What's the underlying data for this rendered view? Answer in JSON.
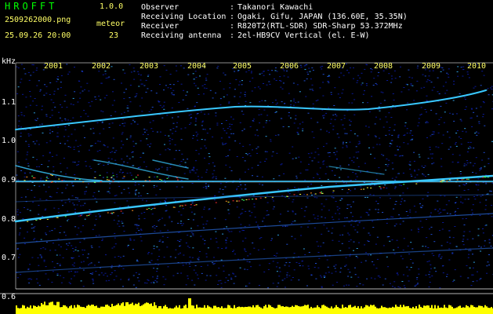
{
  "header": {
    "app_name": "HROFFT",
    "version": "1.0.0",
    "file_name": "2509262000.png",
    "datetime": "25.09.26 20:00",
    "meteor_label": "meteor",
    "meteor_count": "23"
  },
  "info": [
    {
      "key": "Observer",
      "value": "Takanori Kawachi"
    },
    {
      "key": "Receiving Location",
      "value": "Ogaki, Gifu, JAPAN (136.60E, 35.35N)"
    },
    {
      "key": "Receiver",
      "value": "R820T2(RTL-SDR) SDR-Sharp 53.372MHz"
    },
    {
      "key": "Receiving antenna",
      "value": "2el-HB9CV Vertical (el. E-W)"
    }
  ],
  "spectrogram": {
    "unit": "kHz",
    "y_ticks": [
      "1.1",
      "1.0",
      "0.9",
      "0.8",
      "0.7",
      "0.6"
    ],
    "x_ticks": [
      "2001",
      "2002",
      "2003",
      "2004",
      "2005",
      "2006",
      "2007",
      "2008",
      "2009",
      "2010"
    ],
    "colors": {
      "background": "#000000",
      "noise": "#0a1a9a",
      "trace": "#39c8ff",
      "header_green": "#00ff00",
      "header_yellow": "#ffff66",
      "meteor_bar": "#ffff00"
    }
  }
}
